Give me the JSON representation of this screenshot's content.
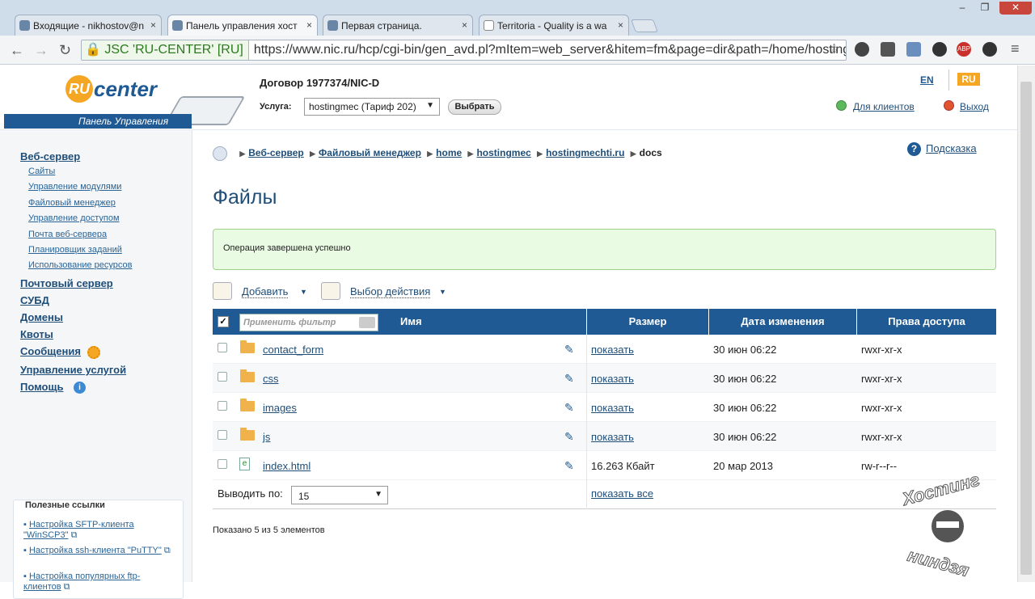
{
  "browser": {
    "tabs": [
      {
        "label": "Входящие - nikhostov@n"
      },
      {
        "label": "Панель управления хост"
      },
      {
        "label": "Первая страница."
      },
      {
        "label": "Territoria - Quality is a wa"
      }
    ],
    "tab_close": "×",
    "window_controls": [
      "–",
      "❐",
      "✕"
    ],
    "ev_label": "JSC 'RU-CENTER' [RU]",
    "url": "https://www.nic.ru/hcp/cgi-bin/gen_avd.pl?mItem=web_server&hitem=fm&page=dir&path=/home/hosting",
    "abp": "ABP"
  },
  "header": {
    "logo_ru": "RU",
    "logo_center": "center",
    "logo_tagline": "Панель Управления",
    "contract": "Договор 1977374/NIC-D",
    "service_label": "Услуга:",
    "service_value": "hostingmec (Тариф 202)",
    "select_button": "Выбрать",
    "lang_en": "EN",
    "lang_ru": "RU",
    "clients_link": "Для клиентов",
    "exit_link": "Выход"
  },
  "sidebar": {
    "main": [
      {
        "label": "Веб-сервер"
      },
      {
        "label": "Почтовый сервер"
      },
      {
        "label": "СУБД"
      },
      {
        "label": "Домены"
      },
      {
        "label": "Квоты"
      },
      {
        "label": "Сообщения"
      },
      {
        "label": "Управление услугой"
      },
      {
        "label": "Помощь"
      }
    ],
    "sub": [
      {
        "label": "Сайты"
      },
      {
        "label": "Управление модулями"
      },
      {
        "label": "Файловый менеджер"
      },
      {
        "label": "Управление доступом"
      },
      {
        "label": "Почта веб-сервера"
      },
      {
        "label": "Планировщик заданий"
      },
      {
        "label": "Использование ресурсов"
      }
    ],
    "useful_title": "Полезные ссылки",
    "useful": [
      {
        "label": "Настройка SFTP-клиента \"WinSCP3\""
      },
      {
        "label": "Настройка ssh-клиента \"PuTTY\""
      },
      {
        "label": "Настройка популярных ftp-клиентов"
      }
    ]
  },
  "breadcrumb": [
    "Веб-сервер",
    "Файловый менеджер",
    "home",
    "hostingmec",
    "hostingmechti.ru",
    "docs"
  ],
  "help_link": "Подсказка",
  "page_title": "Файлы",
  "success_message": "Операция завершена успешно",
  "actions": {
    "add": "Добавить",
    "choose": "Выбор действия"
  },
  "table": {
    "filter_placeholder": "Применить фильтр",
    "columns": {
      "name": "Имя",
      "size": "Размер",
      "date": "Дата изменения",
      "perms": "Права доступа"
    },
    "rows": [
      {
        "name": "contact_form",
        "size": "показать",
        "date": "30 июн 06:22",
        "perms": "rwxr-xr-x"
      },
      {
        "name": "css",
        "size": "показать",
        "date": "30 июн 06:22",
        "perms": "rwxr-xr-x"
      },
      {
        "name": "images",
        "size": "показать",
        "date": "30 июн 06:22",
        "perms": "rwxr-xr-x"
      },
      {
        "name": "js",
        "size": "показать",
        "date": "30 июн 06:22",
        "perms": "rwxr-xr-x"
      },
      {
        "name": "index.html",
        "size": "16.263 Кбайт",
        "date": "20 мар 2013",
        "perms": "rw-r--r--"
      }
    ],
    "per_page_label": "Выводить по:",
    "per_page_value": "15",
    "show_all": "показать все"
  },
  "shown_text": "Показано 5 из 5 элементов",
  "watermark": {
    "top": "Хостинг",
    "bottom": "ниндзя"
  },
  "colors": {
    "brand": "#1f5a94",
    "accent": "#f5a623",
    "success_bg": "#eafbe3"
  }
}
